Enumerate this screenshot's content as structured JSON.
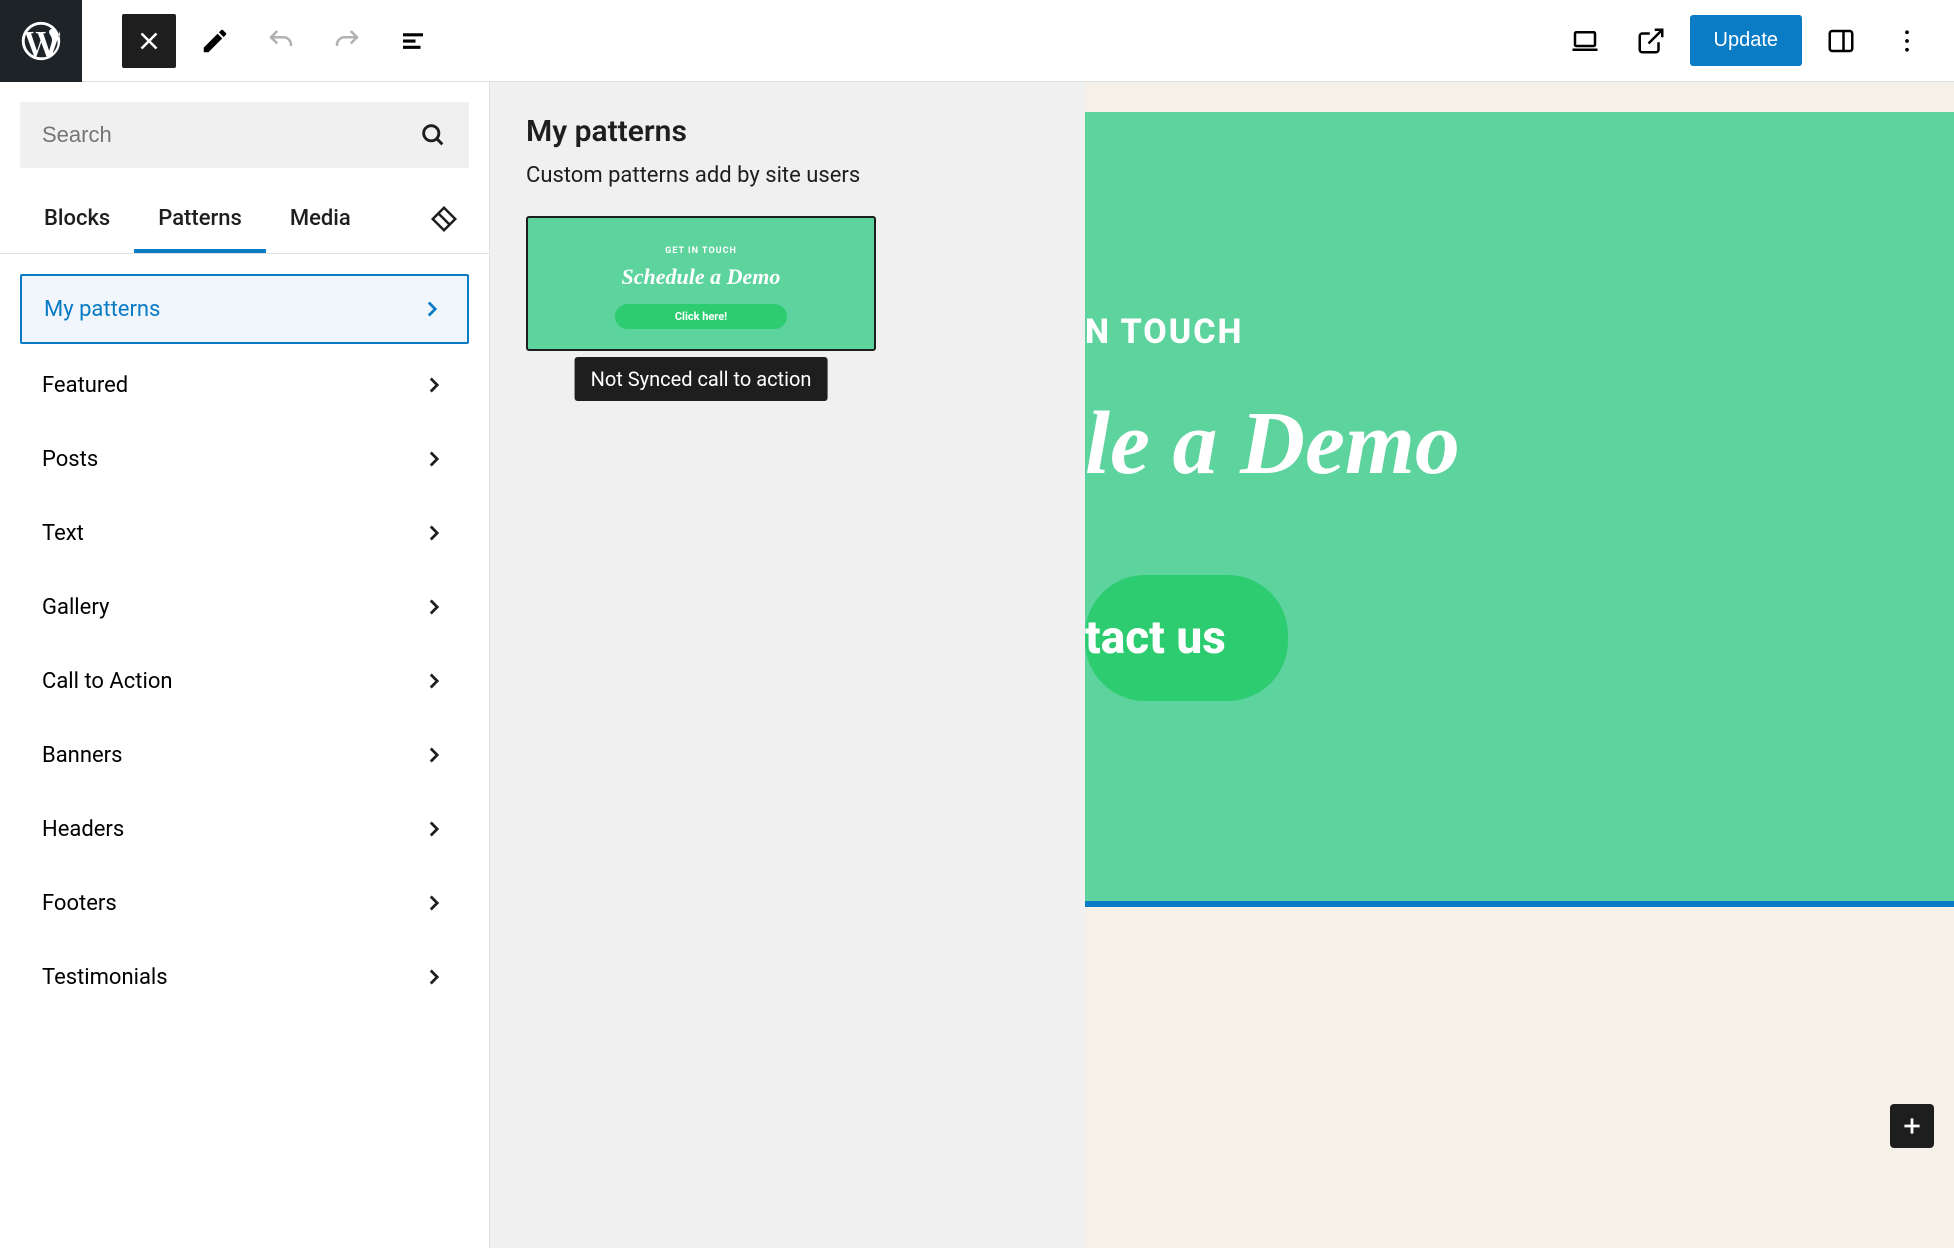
{
  "toolbar": {
    "update_label": "Update"
  },
  "sidebar": {
    "search_placeholder": "Search",
    "tabs": [
      {
        "label": "Blocks"
      },
      {
        "label": "Patterns"
      },
      {
        "label": "Media"
      }
    ],
    "categories": [
      {
        "label": "My patterns"
      },
      {
        "label": "Featured"
      },
      {
        "label": "Posts"
      },
      {
        "label": "Text"
      },
      {
        "label": "Gallery"
      },
      {
        "label": "Call to Action"
      },
      {
        "label": "Banners"
      },
      {
        "label": "Headers"
      },
      {
        "label": "Footers"
      },
      {
        "label": "Testimonials"
      }
    ]
  },
  "panel": {
    "title": "My patterns",
    "description": "Custom patterns add by site users",
    "thumbnail": {
      "overline": "GET IN TOUCH",
      "title": "Schedule a Demo",
      "button": "Click here!",
      "tooltip": "Not Synced call to action"
    }
  },
  "canvas": {
    "overline": "N TOUCH",
    "title": "le a Demo",
    "button": "tact us"
  },
  "colors": {
    "accent": "#0a7bc5",
    "block_bg": "#5dd39e",
    "block_btn": "#2ecc71"
  }
}
